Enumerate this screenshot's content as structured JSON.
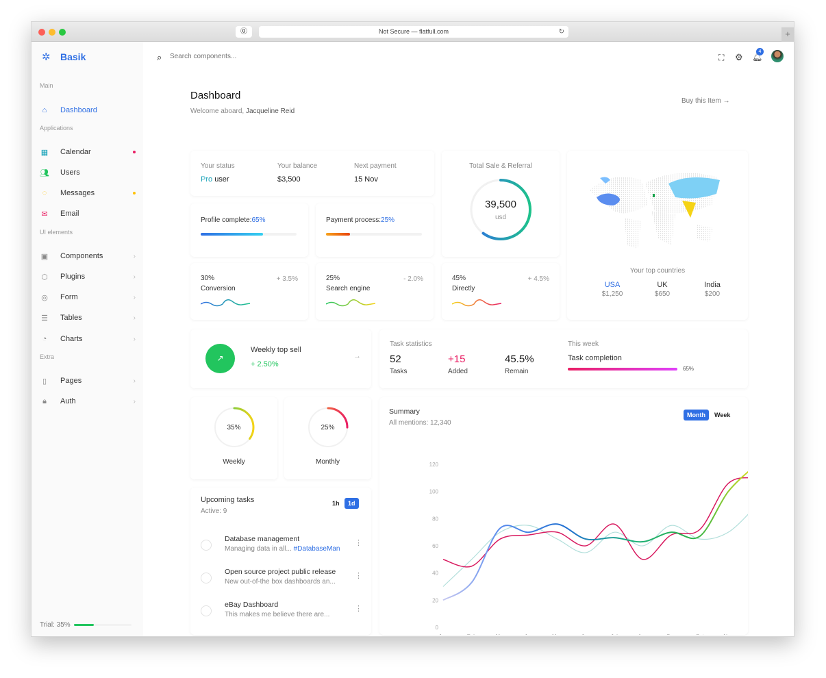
{
  "browser": {
    "url": "Not Secure — flatfull.com"
  },
  "brand": {
    "name": "Basik"
  },
  "search": {
    "placeholder": "Search components..."
  },
  "header": {
    "notification_count": "4"
  },
  "sidebar": {
    "sections": [
      "Main",
      "Applications",
      "UI elements",
      "Extra"
    ],
    "items": [
      {
        "label": "Dashboard",
        "icon": "home-icon"
      },
      {
        "label": "Calendar",
        "icon": "calendar-icon",
        "badge": "#e91e63"
      },
      {
        "label": "Users",
        "icon": "users-icon"
      },
      {
        "label": "Messages",
        "icon": "message-icon",
        "badge": "#ffc107"
      },
      {
        "label": "Email",
        "icon": "mail-icon"
      },
      {
        "label": "Components",
        "icon": "grid-icon"
      },
      {
        "label": "Plugins",
        "icon": "box-icon"
      },
      {
        "label": "Form",
        "icon": "disc-icon"
      },
      {
        "label": "Tables",
        "icon": "list-icon"
      },
      {
        "label": "Charts",
        "icon": "pie-icon"
      },
      {
        "label": "Pages",
        "icon": "file-icon"
      },
      {
        "label": "Auth",
        "icon": "lock-icon"
      }
    ],
    "trial": {
      "label": "Trial: 35%",
      "value": 35
    }
  },
  "page": {
    "title": "Dashboard",
    "welcome": "Welcome aboard,",
    "user": "Jacqueline Reid",
    "buy": "Buy this Item"
  },
  "status": {
    "status_label": "Your status",
    "status_pro": "Pro",
    "status_user": "user",
    "balance_label": "Your balance",
    "balance": "$3,500",
    "next_label": "Next payment",
    "next": "15 Nov"
  },
  "profile": {
    "label": "Profile complete:",
    "value": "65%",
    "pct": 65
  },
  "payment": {
    "label": "Payment process:",
    "value": "25%",
    "pct": 25
  },
  "total": {
    "label": "Total Sale & Referral",
    "value": "39,500",
    "unit": "usd",
    "pct": 60
  },
  "countries": {
    "label": "Your top countries",
    "items": [
      {
        "name": "USA",
        "value": "$1,250"
      },
      {
        "name": "UK",
        "value": "$650"
      },
      {
        "name": "India",
        "value": "$200"
      }
    ]
  },
  "metrics": [
    {
      "pct": "30%",
      "label": "Conversion",
      "change": "+ 3.5%"
    },
    {
      "pct": "25%",
      "label": "Search engine",
      "change": "- 2.0%"
    },
    {
      "pct": "45%",
      "label": "Directly",
      "change": "+ 4.5%"
    }
  ],
  "weekly": {
    "label": "Weekly top sell",
    "change": "+ 2.50%"
  },
  "tasks": {
    "label": "Task statistics",
    "stats": [
      {
        "value": "52",
        "label": "Tasks"
      },
      {
        "value": "+15",
        "label": "Added"
      },
      {
        "value": "45.5%",
        "label": "Remain"
      }
    ]
  },
  "thisweek": {
    "label": "This week",
    "title": "Task completion",
    "value": "65%",
    "pct": 65
  },
  "rings": [
    {
      "value": "35%",
      "label": "Weekly",
      "pct": 35
    },
    {
      "value": "25%",
      "label": "Monthly",
      "pct": 25
    }
  ],
  "upcoming": {
    "title": "Upcoming tasks",
    "active": "Active: 9",
    "tabs": [
      "1h",
      "1d"
    ],
    "items": [
      {
        "title": "Database management",
        "desc": "Managing data in all...",
        "tag": "#DatabaseMan"
      },
      {
        "title": "Open source project public release",
        "desc": "New out-of-the box dashboards an..."
      },
      {
        "title": "eBay Dashboard",
        "desc": "This makes me believe there are..."
      }
    ]
  },
  "summary": {
    "title": "Summary",
    "mentions": "All mentions: 12,340",
    "tabs": [
      "Month",
      "Week"
    ]
  },
  "chart_data": {
    "type": "line",
    "categories": [
      "Jan",
      "Feb",
      "Mar",
      "Apr",
      "May",
      "Jun",
      "Jul",
      "Aug",
      "Sep",
      "Oct",
      "Nov",
      "Dec"
    ],
    "ylim": [
      0,
      120
    ],
    "yticks": [
      "0",
      "20",
      "40",
      "60",
      "80",
      "100",
      "120"
    ],
    "grid": false,
    "series": [
      {
        "values": [
          20,
          33,
          73,
          70,
          76,
          65,
          66,
          63,
          70,
          67,
          100,
          120
        ],
        "color": "gradient blue-green-yellow"
      },
      {
        "values": [
          50,
          45,
          65,
          68,
          70,
          60,
          76,
          50,
          68,
          72,
          106,
          110
        ],
        "color": "#d81b60"
      },
      {
        "values": [
          30,
          50,
          70,
          75,
          65,
          55,
          70,
          60,
          75,
          65,
          70,
          90
        ],
        "color": "#b2dfdb"
      }
    ]
  }
}
